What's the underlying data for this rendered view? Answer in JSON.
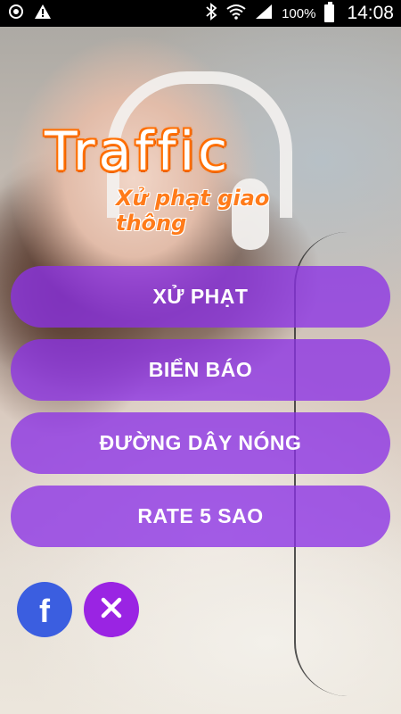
{
  "status_bar": {
    "left_icons": [
      "sync-icon",
      "warning-icon"
    ],
    "right_icons": [
      "bluetooth-icon",
      "wifi-icon",
      "signal-icon",
      "battery-icon"
    ],
    "battery_percent": "100%",
    "time": "14:08"
  },
  "logo": {
    "title": "Traffic",
    "subtitle": "Xử phạt giao thông",
    "title_color": "#ffffff",
    "accent_color": "#ff6a00"
  },
  "menu": {
    "items": [
      {
        "label": "XỬ PHẠT"
      },
      {
        "label": "BIỂN BÁO"
      },
      {
        "label": "ĐƯỜNG DÂY NÓNG"
      },
      {
        "label": "RATE 5 SAO"
      }
    ],
    "button_color": "#8c32e6"
  },
  "social": {
    "facebook": {
      "glyph": "f",
      "icon": "facebook-icon",
      "color": "#3b5ee0"
    },
    "close": {
      "icon": "close-icon",
      "color": "#9a24e3"
    }
  }
}
